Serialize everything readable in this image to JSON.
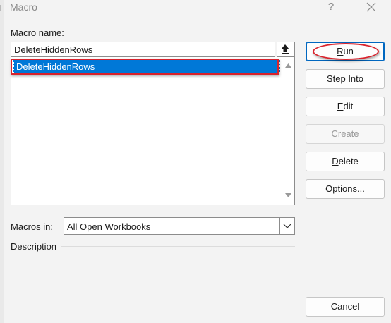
{
  "window": {
    "title": "Macro",
    "help_label": "?",
    "left_strip_mark": "l"
  },
  "macro_name": {
    "label_mnemonic": "M",
    "label_rest": "acro name:",
    "value": "DeleteHiddenRows"
  },
  "macro_list": {
    "items": [
      {
        "label": "DeleteHiddenRows",
        "selected": true
      }
    ]
  },
  "buttons": {
    "run": {
      "mnemonic": "R",
      "rest": "un"
    },
    "step_into": {
      "mnemonic": "S",
      "rest": "tep Into"
    },
    "edit": {
      "mnemonic": "E",
      "rest": "dit"
    },
    "create": {
      "label": "Create",
      "disabled": true
    },
    "delete": {
      "mnemonic": "D",
      "rest": "elete"
    },
    "options": {
      "mnemonic": "O",
      "rest": "ptions..."
    },
    "cancel": {
      "label": "Cancel"
    }
  },
  "macros_in": {
    "label_pre": "M",
    "label_mnemonic": "a",
    "label_rest": "cros in:",
    "selected": "All Open Workbooks"
  },
  "description": {
    "label": "Description"
  },
  "colors": {
    "selection": "#0078d7",
    "highlight_annotation": "#d9232d",
    "dialog_background": "#f3f3f3",
    "default_button_border": "#0067c0"
  },
  "icons": {
    "move_up": "upload-arrow-icon",
    "close": "close-x-icon",
    "scroll_up": "triangle-up-icon",
    "scroll_down": "triangle-down-icon",
    "dropdown": "chevron-down-icon"
  }
}
